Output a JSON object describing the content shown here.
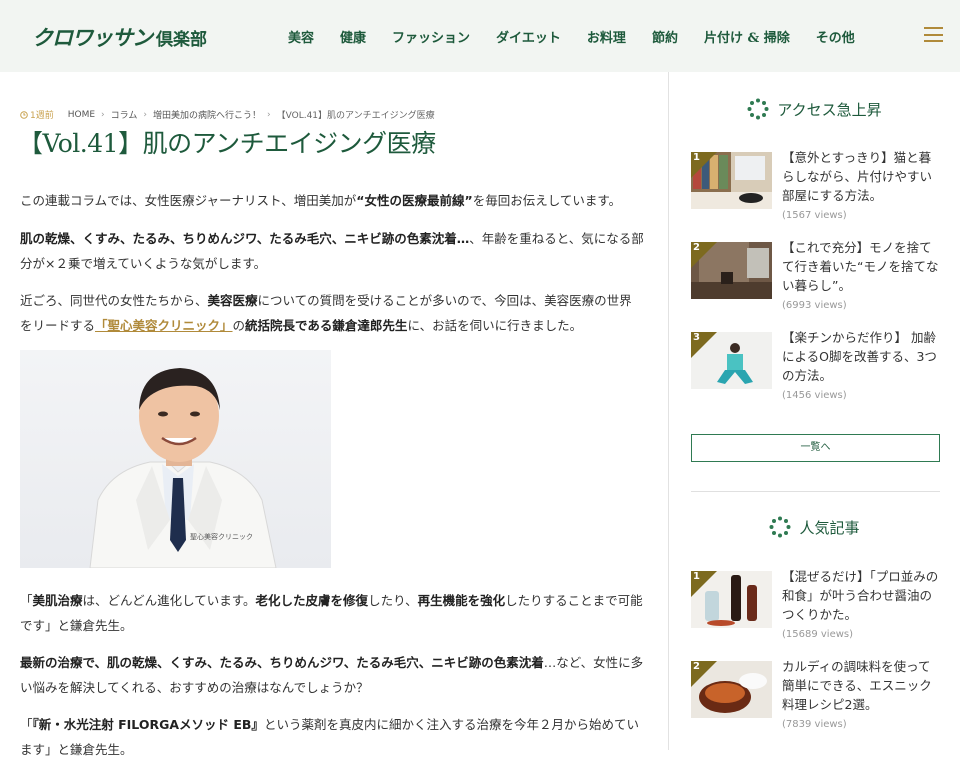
{
  "header": {
    "logo_main": "クロワッサン",
    "logo_sub": "倶楽部",
    "nav": [
      "美容",
      "健康",
      "ファッション",
      "ダイエット",
      "お料理",
      "節約",
      "片付け & 掃除",
      "その他"
    ]
  },
  "breadcrumb": {
    "views": "1週前",
    "items": [
      "HOME",
      "コラム",
      "増田美加の病院へ行こう！",
      "【VOL.41】肌のアンチエイジング医療"
    ]
  },
  "article": {
    "title": "【Vol.41】肌のアンチエイジング医療",
    "p1_a": "この連載コラムでは、女性医療ジャーナリスト、増田美加が",
    "p1_b": "“女性の医療最前線”",
    "p1_c": "を毎回お伝えしています。",
    "p2_a": "肌の乾燥、くすみ、たるみ、ちりめんジワ、たるみ毛穴、ニキビ跡の色素沈着…",
    "p2_b": "、年齢を重ねると、気になる部分が×２乗で増えていくような気がします。",
    "p3_a": "近ごろ、同世代の女性たちから、",
    "p3_b": "美容医療",
    "p3_c": "についての質問を受けることが多いので、今回は、美容医療の世界をリードする",
    "p3_link": "「聖心美容クリニック」",
    "p3_d": "の",
    "p3_e": "統括院長である鎌倉達郎先生",
    "p3_f": "に、お話を伺いに行きました。",
    "coat_text": "聖心美容クリニック",
    "p4_a": "「",
    "p4_b": "美肌治療",
    "p4_c": "は、どんどん進化しています。",
    "p4_d": "老化した皮膚を修復",
    "p4_e": "したり、",
    "p4_f": "再生機能を強化",
    "p4_g": "したりすることまで可能です」と鎌倉先生。",
    "p5_a": "最新の治療で、肌の乾燥、くすみ、たるみ、ちりめんジワ、たるみ毛穴、ニキビ跡の色素沈着",
    "p5_b": "…など、女性に多い悩みを解決してくれる、おすすめの治療はなんでしょうか？",
    "p6_a": "「",
    "p6_b": "『新・水光注射 FILORGAメソッド EB』",
    "p6_c": "という薬剤を真皮内に細かく注入する治療を今年２月から始めています」と鎌倉先生。"
  },
  "sidebar": {
    "access_title": "アクセス急上昇",
    "access_items": [
      {
        "rank": "1",
        "title": "【意外とすっきり】猫と暮らしながら、片付けやすい部屋にする方法。",
        "views": "(1567 views)"
      },
      {
        "rank": "2",
        "title": "【これで充分】モノを捨てて行き着いた“モノを捨てない暮らし”。",
        "views": "(6993 views)"
      },
      {
        "rank": "3",
        "title": "【楽チンからだ作り】 加齢によるO脚を改善する、3つの方法。",
        "views": "(1456 views)"
      }
    ],
    "list_button": "一覧へ",
    "popular_title": "人気記事",
    "popular_items": [
      {
        "rank": "1",
        "title": "【混ぜるだけ】「プロ並みの和食」が叶う合わせ醤油のつくりかた。",
        "views": "(15689 views)"
      },
      {
        "rank": "2",
        "title": "カルディの調味料を使って簡単にできる、エスニック料理レシピ2選。",
        "views": "(7839 views)"
      }
    ]
  },
  "colors": {
    "brand_green": "#1e5a3c",
    "accent_gold": "#b08a3a",
    "header_bg": "#f2f5f2",
    "rank_badge": "#7d6a1f"
  }
}
